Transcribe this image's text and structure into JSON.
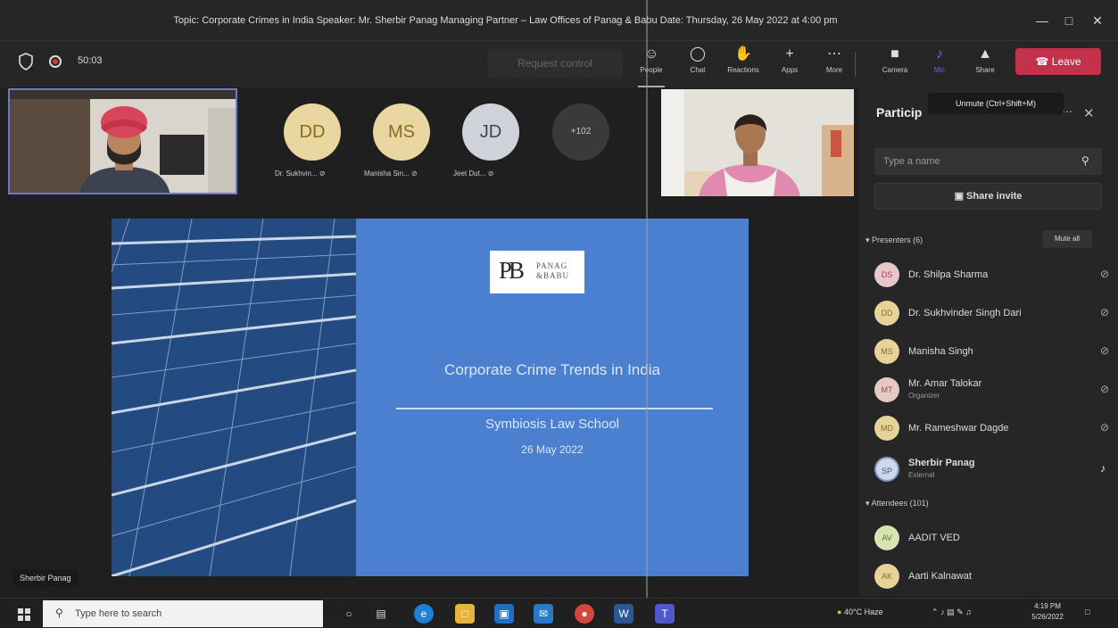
{
  "window": {
    "title": "Topic: Corporate Crimes in India Speaker: Mr. Sherbir Panag Managing Partner – Law Offices of Panag & Babu Date: Thursday, 26 May 2022 at 4:00 pm",
    "minimize_icon": "minimize-icon",
    "maximize_icon": "maximize-icon",
    "close_icon": "close-icon"
  },
  "toolbar": {
    "timer": "50:03",
    "request_control": "Request control",
    "tools": [
      {
        "label": "People",
        "icon": "people-icon"
      },
      {
        "label": "Chat",
        "icon": "chat-icon"
      },
      {
        "label": "Reactions",
        "icon": "reactions-icon"
      },
      {
        "label": "Apps",
        "icon": "plus-icon"
      },
      {
        "label": "More",
        "icon": "more-icon"
      },
      {
        "label": "Camera",
        "icon": "camera-icon"
      },
      {
        "label": "Mic",
        "icon": "mic-off-icon"
      },
      {
        "label": "Share",
        "icon": "share-icon"
      }
    ],
    "leave_label": "Leave"
  },
  "gallery": {
    "avatars": [
      {
        "initials": "DD",
        "name": "Dr. Sukhvin...",
        "color": "#e9d6a0"
      },
      {
        "initials": "MS",
        "name": "Manisha Sin...",
        "color": "#e9d6a0"
      },
      {
        "initials": "JD",
        "name": "Jeet Dut...",
        "color": "#cfd3d9"
      }
    ],
    "more_count": "+102"
  },
  "slide": {
    "logo_mark": "PB",
    "logo_line1": "PANAG",
    "logo_line2": "&BABU",
    "title": "Corporate Crime Trends in India",
    "subtitle": "Symbiosis Law School",
    "date": "26 May 2022"
  },
  "stage": {
    "speaker_name_tag": "Sherbir Panag"
  },
  "panel": {
    "title": "Particip",
    "tooltip": "Unmute (Ctrl+Shift+M)",
    "search_placeholder": "Type a name",
    "share_invite": "Share invite",
    "presenters_header": "Presenters (6)",
    "mute_all": "Mute all",
    "presenters": [
      {
        "initials": "DS",
        "name": "Dr. Shilpa Sharma",
        "role": "",
        "color": "#e8c6cc",
        "text": "#b3404f"
      },
      {
        "initials": "DD",
        "name": "Dr. Sukhvinder Singh Dari",
        "role": "",
        "color": "#e6d39a",
        "text": "#8a6d1f"
      },
      {
        "initials": "MS",
        "name": "Manisha Singh",
        "role": "",
        "color": "#e6d39a",
        "text": "#8a6d1f"
      },
      {
        "initials": "MT",
        "name": "Mr. Amar Talokar",
        "role": "Organizer",
        "color": "#e5c9c4",
        "text": "#9e4a3e"
      },
      {
        "initials": "MD",
        "name": "Mr. Rameshwar Dagde",
        "role": "",
        "color": "#e6d39a",
        "text": "#8a6d1f"
      },
      {
        "initials": "SP",
        "name": "Sherbir Panag",
        "role": "External",
        "color": "#cdd8ea",
        "text": "#3f5a8a"
      }
    ],
    "attendees_header": "Attendees (101)",
    "attendees": [
      {
        "initials": "AV",
        "name": "AADIT VED",
        "color": "#d6e3b4",
        "text": "#5a7a22"
      },
      {
        "initials": "AK",
        "name": "Aarti Kalnawat",
        "color": "#e6d39a",
        "text": "#8a6d1f"
      }
    ]
  },
  "taskbar": {
    "search_placeholder": "Type here to search",
    "weather": "40°C  Haze",
    "time": "4:19 PM",
    "date": "5/26/2022"
  }
}
